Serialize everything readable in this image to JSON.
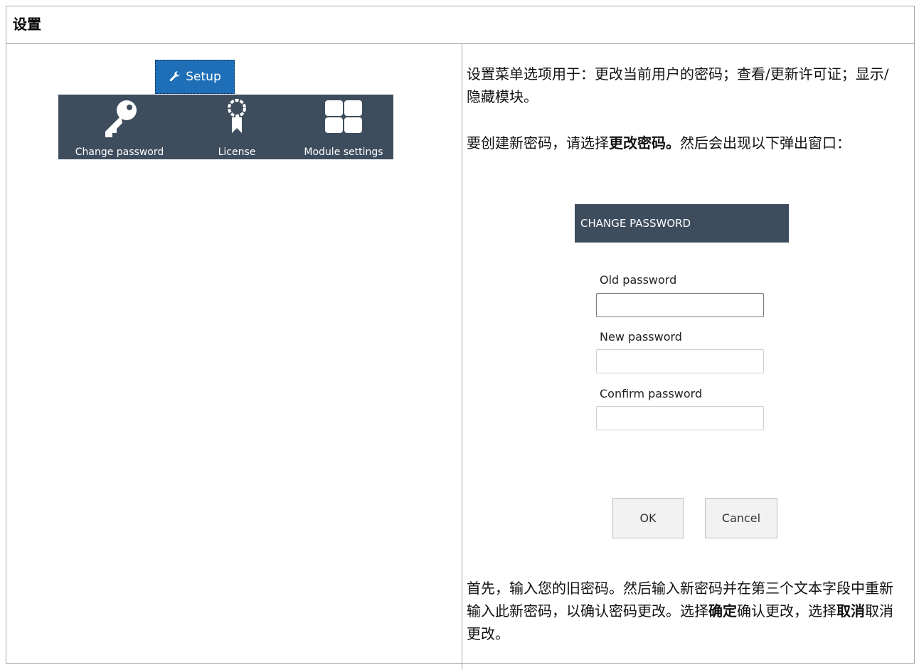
{
  "section": {
    "title": "设置"
  },
  "ribbon": {
    "tab_label": "Setup",
    "tab_icon": "wrench-icon",
    "items": [
      {
        "label": "Change password",
        "icon": "key-icon"
      },
      {
        "label": "License",
        "icon": "ribbon-award-icon"
      },
      {
        "label": "Module settings",
        "icon": "grid-icon"
      }
    ],
    "colors": {
      "tab": "#1e6fb8",
      "bar": "#3e4d5e"
    }
  },
  "text": {
    "intro": "设置菜单选项用于：更改当前用户的密码；查看/更新许可证；显示/隐藏模块。",
    "create_prefix": "要创建新密码，请选择",
    "create_bold": "更改密码。",
    "create_suffix": "然后会出现以下弹出窗口：",
    "final_part1": "首先，输入您的旧密码。然后输入新密码并在第三个文本字段中重新输入此新密码，以确认密码更改。选择",
    "final_ok_bold": "确定",
    "final_part2": "确认更改，选择",
    "final_cancel_bold": "取消",
    "final_part3": "取消更改。"
  },
  "dialog": {
    "title": "CHANGE PASSWORD",
    "fields": [
      {
        "label": "Old password",
        "value": ""
      },
      {
        "label": "New password",
        "value": ""
      },
      {
        "label": "Confirm password",
        "value": ""
      }
    ],
    "ok_label": "OK",
    "cancel_label": "Cancel"
  }
}
